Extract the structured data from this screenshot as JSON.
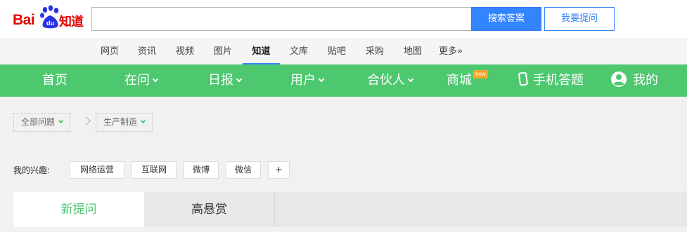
{
  "logo": {
    "bai": "Bai",
    "du": "du",
    "zhidao": "知道"
  },
  "search": {
    "value": "",
    "placeholder": "",
    "button_label": "搜索答案",
    "ask_label": "我要提问"
  },
  "channels": [
    "网页",
    "资讯",
    "视频",
    "图片",
    "知道",
    "文库",
    "贴吧",
    "采购",
    "地图",
    "更多»"
  ],
  "active_channel": "知道",
  "nav": {
    "home": "首页",
    "zaiwen": "在问",
    "ribao": "日报",
    "users": "用户",
    "partner": "合伙人",
    "mall": "商城",
    "mall_badge": "new",
    "mobile": "手机答题",
    "mine": "我的"
  },
  "breadcrumb": {
    "all": "全部问题",
    "category": "生产制造"
  },
  "interests": {
    "label": "我的兴趣:",
    "tags": [
      "网络运营",
      "互联网",
      "微博",
      "微信"
    ],
    "add": "+"
  },
  "tabs": {
    "new": "新提问",
    "bounty": "高悬赏"
  },
  "colors": {
    "accent_green": "#4dc86f",
    "accent_blue": "#3385ff",
    "logo_red": "#e10602",
    "badge_orange": "#f8a62c"
  }
}
